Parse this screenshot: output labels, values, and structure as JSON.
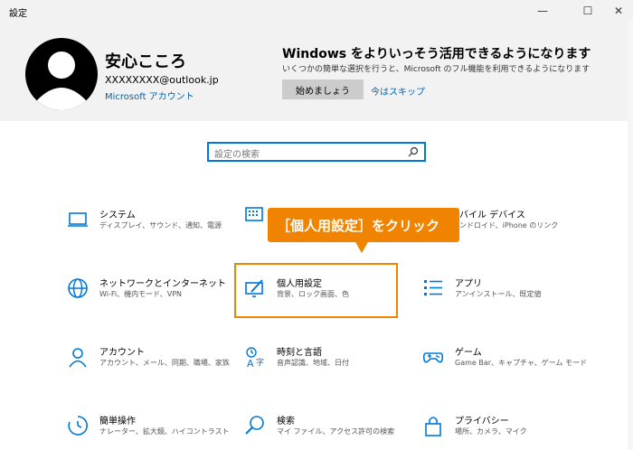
{
  "window": {
    "title": "設定",
    "min_glyph": "—",
    "max_glyph": "☐",
    "close_glyph": "✕"
  },
  "user": {
    "name": "安心こころ",
    "email": "XXXXXXXX@outlook.jp",
    "account_link": "Microsoft アカウント"
  },
  "promo": {
    "title": "Windows をよりいっそう活用できるようになります",
    "description": "いくつかの簡単な選択を行うと、Microsoft のフル機能を利用できるようになります",
    "start_button": "始めましょう",
    "skip_link": "今はスキップ"
  },
  "search": {
    "placeholder": "設定の検索"
  },
  "tiles": [
    {
      "title": "システム",
      "desc": "ディスプレイ、サウンド、通知、電源"
    },
    {
      "title": "",
      "desc": ""
    },
    {
      "title": "バイル デバイス",
      "desc": "ンドロイド、iPhone のリンク"
    },
    {
      "title": "ネットワークとインターネット",
      "desc": "Wi-Fi、機内モード、VPN"
    },
    {
      "title": "個人用設定",
      "desc": "背景、ロック画面、色"
    },
    {
      "title": "アプリ",
      "desc": "アンインストール、既定値"
    },
    {
      "title": "アカウント",
      "desc": "アカウント、メール、同期、職場、家族"
    },
    {
      "title": "時刻と言語",
      "desc": "音声認識、地域、日付"
    },
    {
      "title": "ゲーム",
      "desc": "Game Bar、キャプチャ、ゲーム モード"
    },
    {
      "title": "簡単操作",
      "desc": "ナレーター、拡大鏡、ハイコントラスト"
    },
    {
      "title": "検索",
      "desc": "マイ ファイル、アクセス許可の検索"
    },
    {
      "title": "プライバシー",
      "desc": "場所、カメラ、マイク"
    }
  ],
  "callout": {
    "text": "［個人用設定］をクリック"
  },
  "colors": {
    "accent": "#0078d7",
    "highlight": "#f08300",
    "header_bg": "#f2f2f2"
  }
}
